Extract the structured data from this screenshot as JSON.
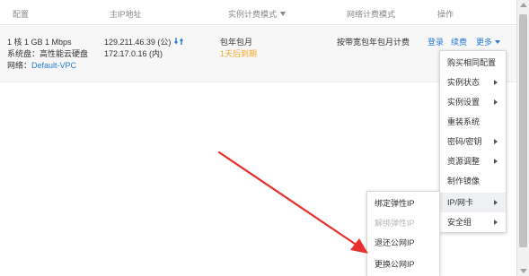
{
  "header": {
    "col_config": "配置",
    "col_ip": "主IP地址",
    "col_billing": "实例计费模式",
    "col_network_billing": "网络计费模式",
    "col_actions": "操作"
  },
  "row": {
    "spec": "1 核 1 GB 1 Mbps",
    "disk": "系统盘：高性能云硬盘",
    "network_label": "网络：",
    "network_value": "Default-VPC",
    "public_ip": "129.211.46.39 (公)",
    "private_ip": "172.17.0.16 (内)",
    "billing": "包年包月",
    "expiry": "1天后到期",
    "network_billing": "按带宽包年包月计费",
    "action_login": "登录",
    "action_renew": "续费",
    "action_more": "更多"
  },
  "menu": {
    "items": [
      {
        "label": "购买相同配置"
      },
      {
        "label": "实例状态"
      },
      {
        "label": "实例设置"
      },
      {
        "label": "重装系统"
      },
      {
        "label": "密码/密钥"
      },
      {
        "label": "资源调整"
      },
      {
        "label": "制作镜像"
      },
      {
        "label": "IP/网卡"
      },
      {
        "label": "安全组"
      }
    ]
  },
  "submenu": {
    "items": [
      {
        "label": "绑定弹性IP"
      },
      {
        "label": "解绑弹性IP"
      },
      {
        "label": "退还公网IP"
      },
      {
        "label": "更换公网IP"
      }
    ]
  },
  "colors": {
    "link": "#2a7ad5",
    "warning": "#f5a623",
    "annotation_arrow": "#e8312f"
  }
}
